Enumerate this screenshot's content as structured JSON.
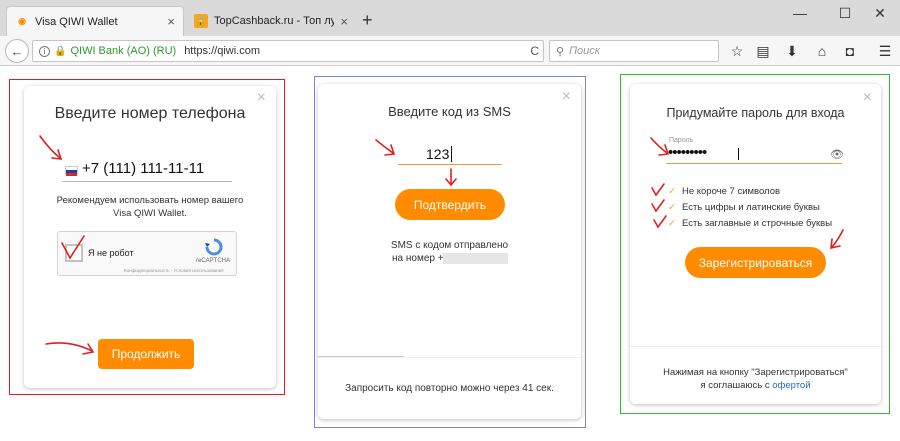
{
  "browser": {
    "tabs": [
      {
        "title": "Visa QIWI Wallet",
        "close": "×",
        "active": true
      },
      {
        "title": "TopCashback.ru - Топ лу...",
        "close": "×",
        "active": false
      }
    ],
    "new_tab": "+",
    "window_controls": {
      "minimize": "—",
      "maximize": "☐",
      "close": "✕"
    },
    "back": "←",
    "address": {
      "info_icon": "i",
      "organization": "QIWI Bank (AO) (RU)",
      "url": "https://qiwi.com",
      "reload": "C"
    },
    "search": {
      "placeholder": "Поиск"
    }
  },
  "panel_phone": {
    "title": "Введите номер телефона",
    "close": "×",
    "phone_value": "+7 (111) 111-11-11",
    "hint_line1": "Рекомендуем использовать номер вашего",
    "hint_line2": "Visa QIWI Wallet.",
    "captcha_label": "Я не робот",
    "captcha_brand": "reCAPTCHA",
    "captcha_footer": "Конфиденциальность - Условия использования",
    "continue_button": "Продолжить"
  },
  "panel_sms": {
    "title": "Введите код из SMS",
    "close": "×",
    "code_value": "123",
    "confirm_button": "Подтвердить",
    "sent_line1": "SMS с кодом отправлено",
    "sent_line2": "на номер +",
    "resend_text": "Запросить код повторно можно через 41 сек."
  },
  "panel_password": {
    "title": "Придумайте пароль для входа",
    "close": "×",
    "field_label": "Пароль",
    "password_value": "•••••••••",
    "rules": [
      {
        "text": "Не короче 7 символов"
      },
      {
        "text": "Есть цифры и латинские буквы"
      },
      {
        "text": "Есть заглавные и строчные буквы"
      }
    ],
    "register_button": "Зарегистрироваться",
    "terms_line1": "Нажимая на кнопку \"Зарегистрироваться\"",
    "terms_line2": "я соглашаюсь с ",
    "terms_link": "офертой"
  },
  "colors": {
    "accent": "#ff8c00",
    "frame_left": "#e02020",
    "frame_middle": "#8080e0",
    "frame_right": "#30c030",
    "annotation": "#e02020",
    "link": "#1a6ec8"
  }
}
